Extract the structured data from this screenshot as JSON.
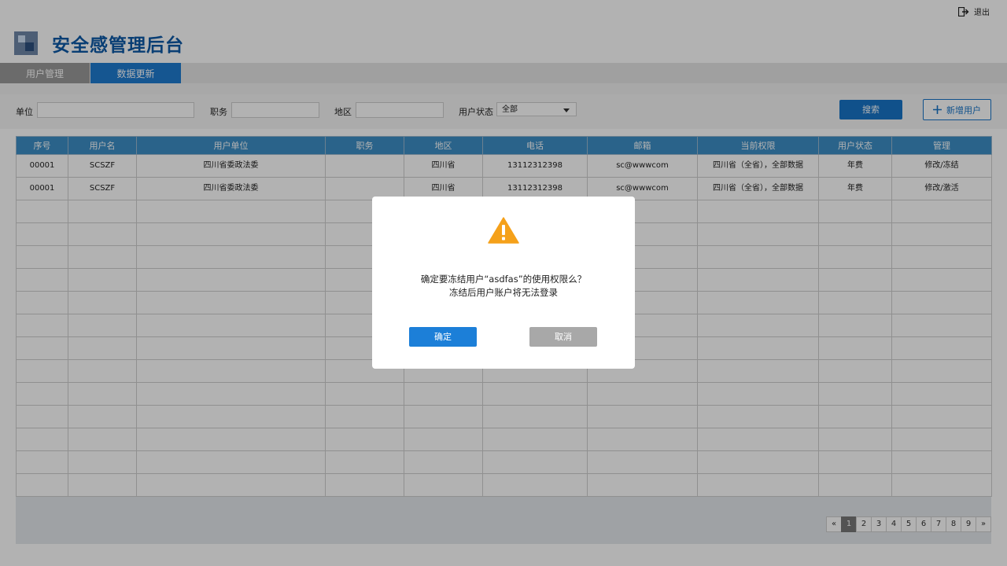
{
  "header": {
    "logout_label": "退出",
    "title": "安全感管理后台"
  },
  "tabs": [
    {
      "label": "用户管理"
    },
    {
      "label": "数据更新"
    }
  ],
  "filter": {
    "unit_label": "单位",
    "position_label": "职务",
    "region_label": "地区",
    "status_label": "用户状态",
    "status_value": "全部",
    "search_button": "搜索",
    "add_button": "新增用户"
  },
  "table": {
    "columns": [
      "序号",
      "用户名",
      "用户单位",
      "职务",
      "地区",
      "电话",
      "邮箱",
      "当前权限",
      "用户状态",
      "管理"
    ],
    "rows": [
      [
        "00001",
        "SCSZF",
        "四川省委政法委",
        "",
        "四川省",
        "13112312398",
        "sc@wwwcom",
        "四川省（全省），全部数据",
        "年费",
        "修改/冻结"
      ],
      [
        "00001",
        "SCSZF",
        "四川省委政法委",
        "",
        "四川省",
        "13112312398",
        "sc@wwwcom",
        "四川省（全省），全部数据",
        "年费",
        "修改/激活"
      ]
    ]
  },
  "pager": {
    "prev": "«",
    "pages": [
      "1",
      "2",
      "3",
      "4",
      "5",
      "6",
      "7",
      "8",
      "9"
    ],
    "next": "»",
    "current": "1"
  },
  "dialog": {
    "line1": "确定要冻结用户“asdfas”的使用权限么？",
    "line2": "冻结后用户账户将无法登录",
    "confirm": "确定",
    "cancel": "取消"
  },
  "colors": {
    "brand": "#0d5aa7",
    "accent": "#1774c8",
    "table_header": "#3d8fc6",
    "warning": "#f5a11a"
  }
}
